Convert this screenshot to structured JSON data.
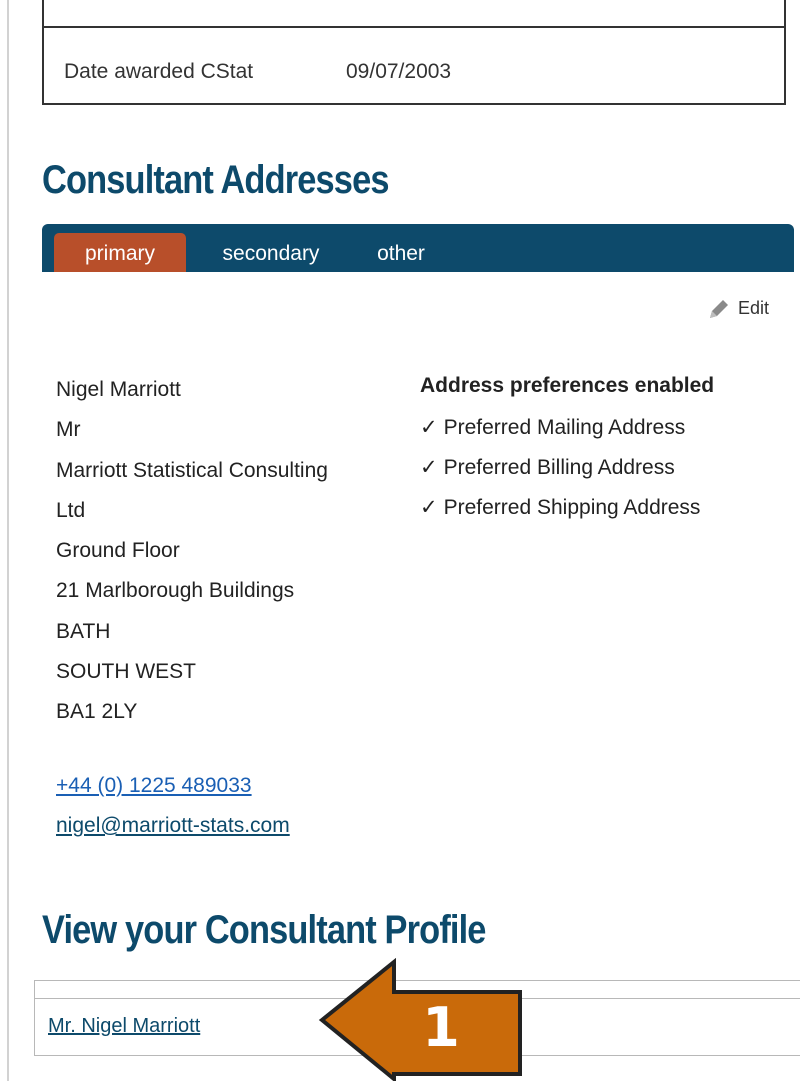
{
  "award": {
    "label": "Date awarded CStat",
    "value": "09/07/2003"
  },
  "addresses": {
    "heading": "Consultant Addresses",
    "tabs": [
      {
        "label": "primary",
        "active": true
      },
      {
        "label": "secondary",
        "active": false
      },
      {
        "label": "other",
        "active": false
      }
    ],
    "edit_label": "Edit",
    "lines": [
      "Nigel Marriott",
      "Mr",
      "Marriott Statistical Consulting",
      "Ltd",
      "Ground Floor",
      "21 Marlborough Buildings",
      "BATH",
      "SOUTH WEST",
      "BA1 2LY"
    ],
    "phone": "+44 (0) 1225 489033",
    "email": "nigel@marriott-stats.com",
    "preferences": {
      "title": "Address preferences enabled",
      "check_glyph": "✓",
      "items": [
        "Preferred Mailing Address",
        "Preferred Billing Address",
        "Preferred Shipping Address"
      ]
    }
  },
  "profile": {
    "heading": "View your Consultant Profile",
    "link_label": "Mr. Nigel Marriott"
  },
  "callout": {
    "number": "1",
    "icon": "left-arrow-callout-icon"
  },
  "colors": {
    "heading": "#0d4a6b",
    "tab_bar": "#0d4a6b",
    "active_tab": "#b84f2a",
    "link": "#1a5fb4",
    "callout_fill": "#c96a0a",
    "callout_stroke": "#222222"
  }
}
